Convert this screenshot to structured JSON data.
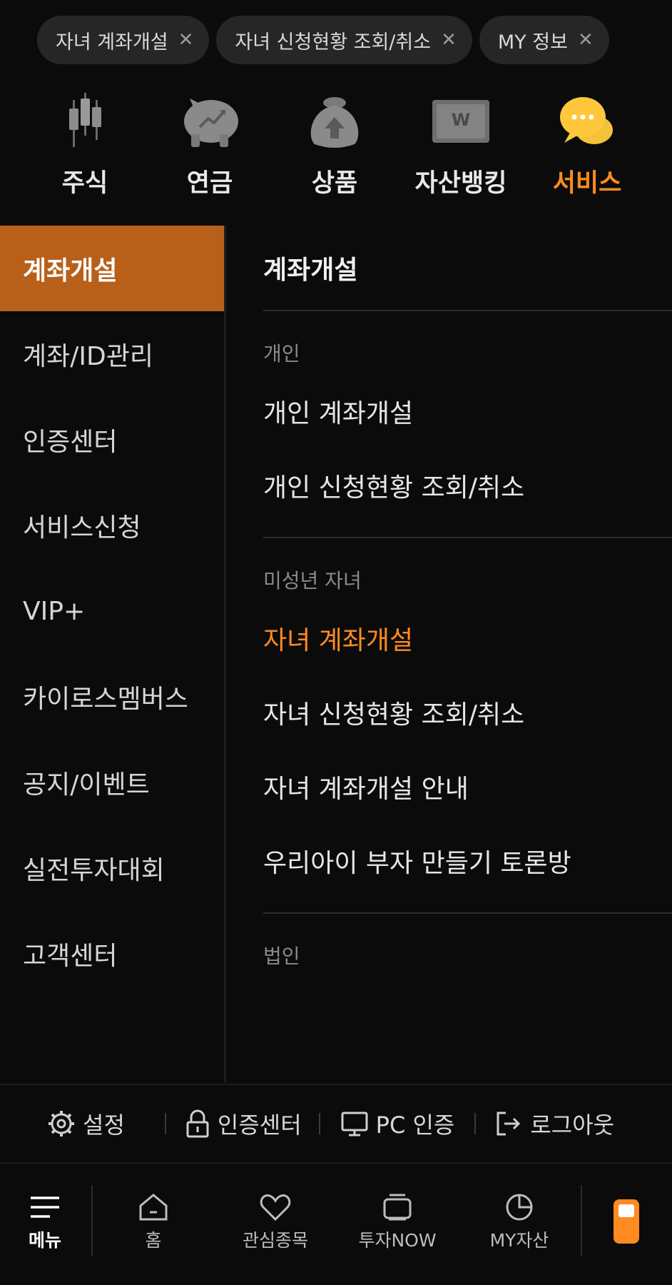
{
  "tabs": [
    {
      "label": "자녀 계좌개설",
      "close": "✕"
    },
    {
      "label": "자녀 신청현황 조회/취소",
      "close": "✕"
    },
    {
      "label": "MY 정보",
      "close": "✕"
    }
  ],
  "categories": [
    {
      "label": "주식",
      "icon": "candlestick-icon"
    },
    {
      "label": "연금",
      "icon": "piggy-bank-icon"
    },
    {
      "label": "상품",
      "icon": "money-bag-icon"
    },
    {
      "label": "자산뱅킹",
      "icon": "won-card-icon"
    },
    {
      "label": "서비스",
      "icon": "chat-bubbles-icon",
      "active": true
    }
  ],
  "left_menu": {
    "items": [
      {
        "label": "계좌개설",
        "active": true
      },
      {
        "label": "계좌/ID관리"
      },
      {
        "label": "인증센터"
      },
      {
        "label": "서비스신청"
      },
      {
        "label": "VIP+"
      },
      {
        "label": "카이로스멤버스"
      },
      {
        "label": "공지/이벤트"
      },
      {
        "label": "실전투자대회"
      },
      {
        "label": "고객센터"
      }
    ]
  },
  "right_panel": {
    "title": "계좌개설",
    "sections": [
      {
        "heading": "개인",
        "links": [
          "개인 계좌개설",
          "개인 신청현황 조회/취소"
        ]
      },
      {
        "heading": "미성년 자녀",
        "links": [
          "자녀 계좌개설",
          "자녀 신청현황 조회/취소",
          "자녀 계좌개설 안내",
          "우리아이 부자 만들기 토론방"
        ]
      },
      {
        "heading": "법인",
        "links": []
      }
    ]
  },
  "util_bar": {
    "settings": "설정",
    "auth_center": "인증센터",
    "pc_auth": "PC 인증",
    "logout": "로그아웃"
  },
  "bottom_nav": {
    "menu": "메뉴",
    "home": "홈",
    "watchlist": "관심종목",
    "invest_now": "투자NOW",
    "my_assets": "MY자산"
  },
  "colors": {
    "accent": "#ff8a1f",
    "active_menu_bg": "#b8601a",
    "background": "#0b0b0b"
  }
}
